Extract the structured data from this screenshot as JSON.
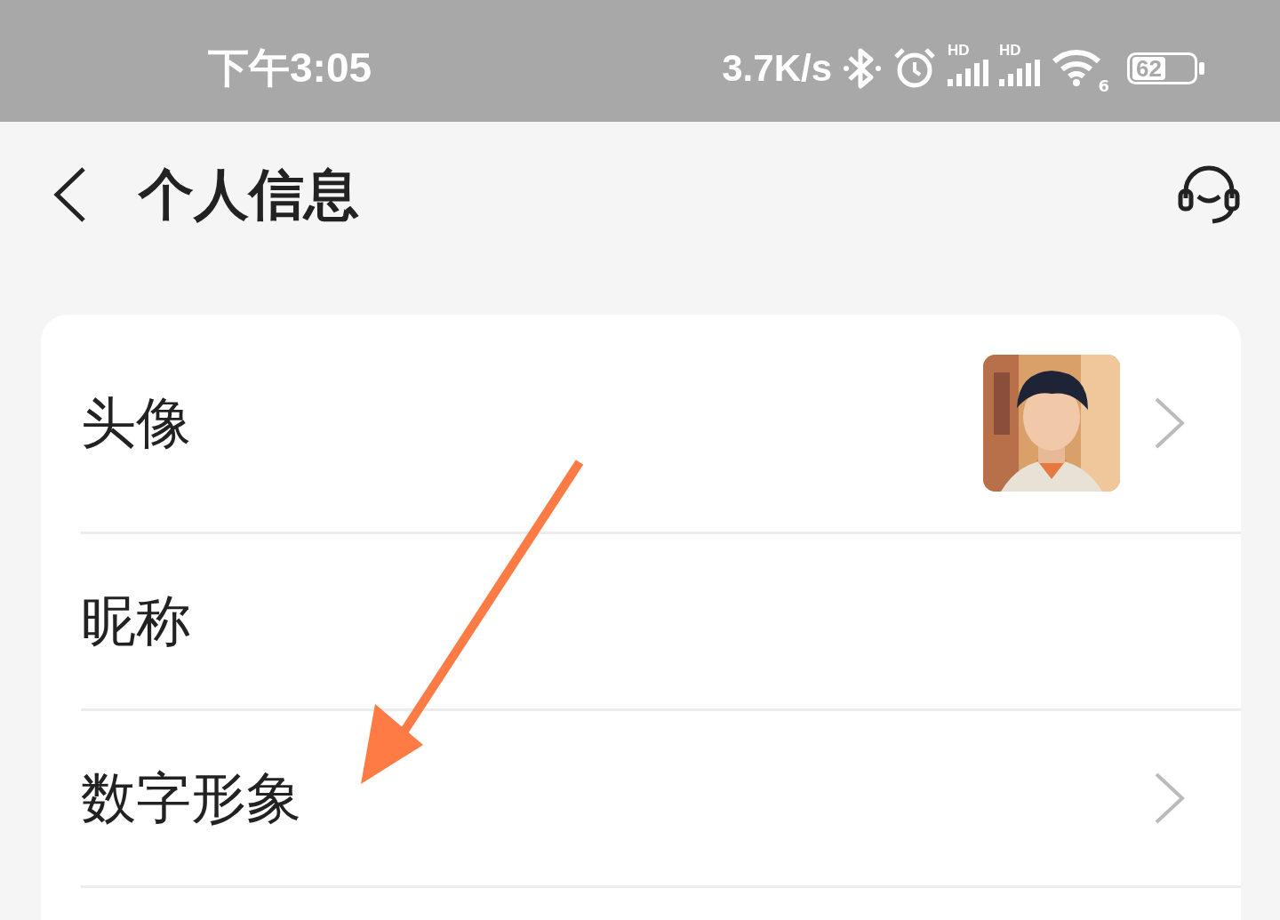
{
  "status_bar": {
    "time": "下午3:05",
    "net_speed": "3.7K/s",
    "signal_labels": [
      "HD",
      "HD"
    ],
    "wifi_label": "6",
    "battery": "62"
  },
  "header": {
    "title": "个人信息"
  },
  "rows": [
    {
      "label": "头像",
      "kind": "avatar",
      "chevron": true
    },
    {
      "label": "昵称",
      "kind": "plain",
      "chevron": false
    },
    {
      "label": "数字形象",
      "kind": "plain",
      "chevron": true
    },
    {
      "kind": "empty",
      "chevron": false
    }
  ],
  "annotation": {
    "kind": "arrow"
  }
}
